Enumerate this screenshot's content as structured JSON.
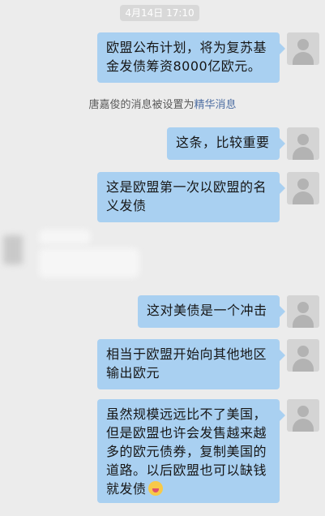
{
  "chat": {
    "timestamp": "4月14日 17:10",
    "notice": {
      "prefix": "唐嘉俊的消息被设置为",
      "highlight": "精华消息"
    },
    "messages": [
      {
        "text": "欧盟公布计划，将为复苏基金发债筹资8000亿欧元。"
      },
      {
        "text": "这条，比较重要"
      },
      {
        "text": "这是欧盟第一次以欧盟的名义发债"
      },
      {
        "text": "这对美债是一个冲击"
      },
      {
        "text": "相当于欧盟开始向其他地区输出欧元"
      },
      {
        "text": "虽然规模远远比不了美国，但是欧盟也许会发售越来越多的欧元债券，复制美国的道路。以后欧盟也可以缺钱就发债",
        "emoji": "face-with-tongue-emoji"
      }
    ]
  },
  "colors": {
    "background": "#ececec",
    "bubble": "#a9d0f1",
    "notice_highlight": "#4f6fa3"
  }
}
